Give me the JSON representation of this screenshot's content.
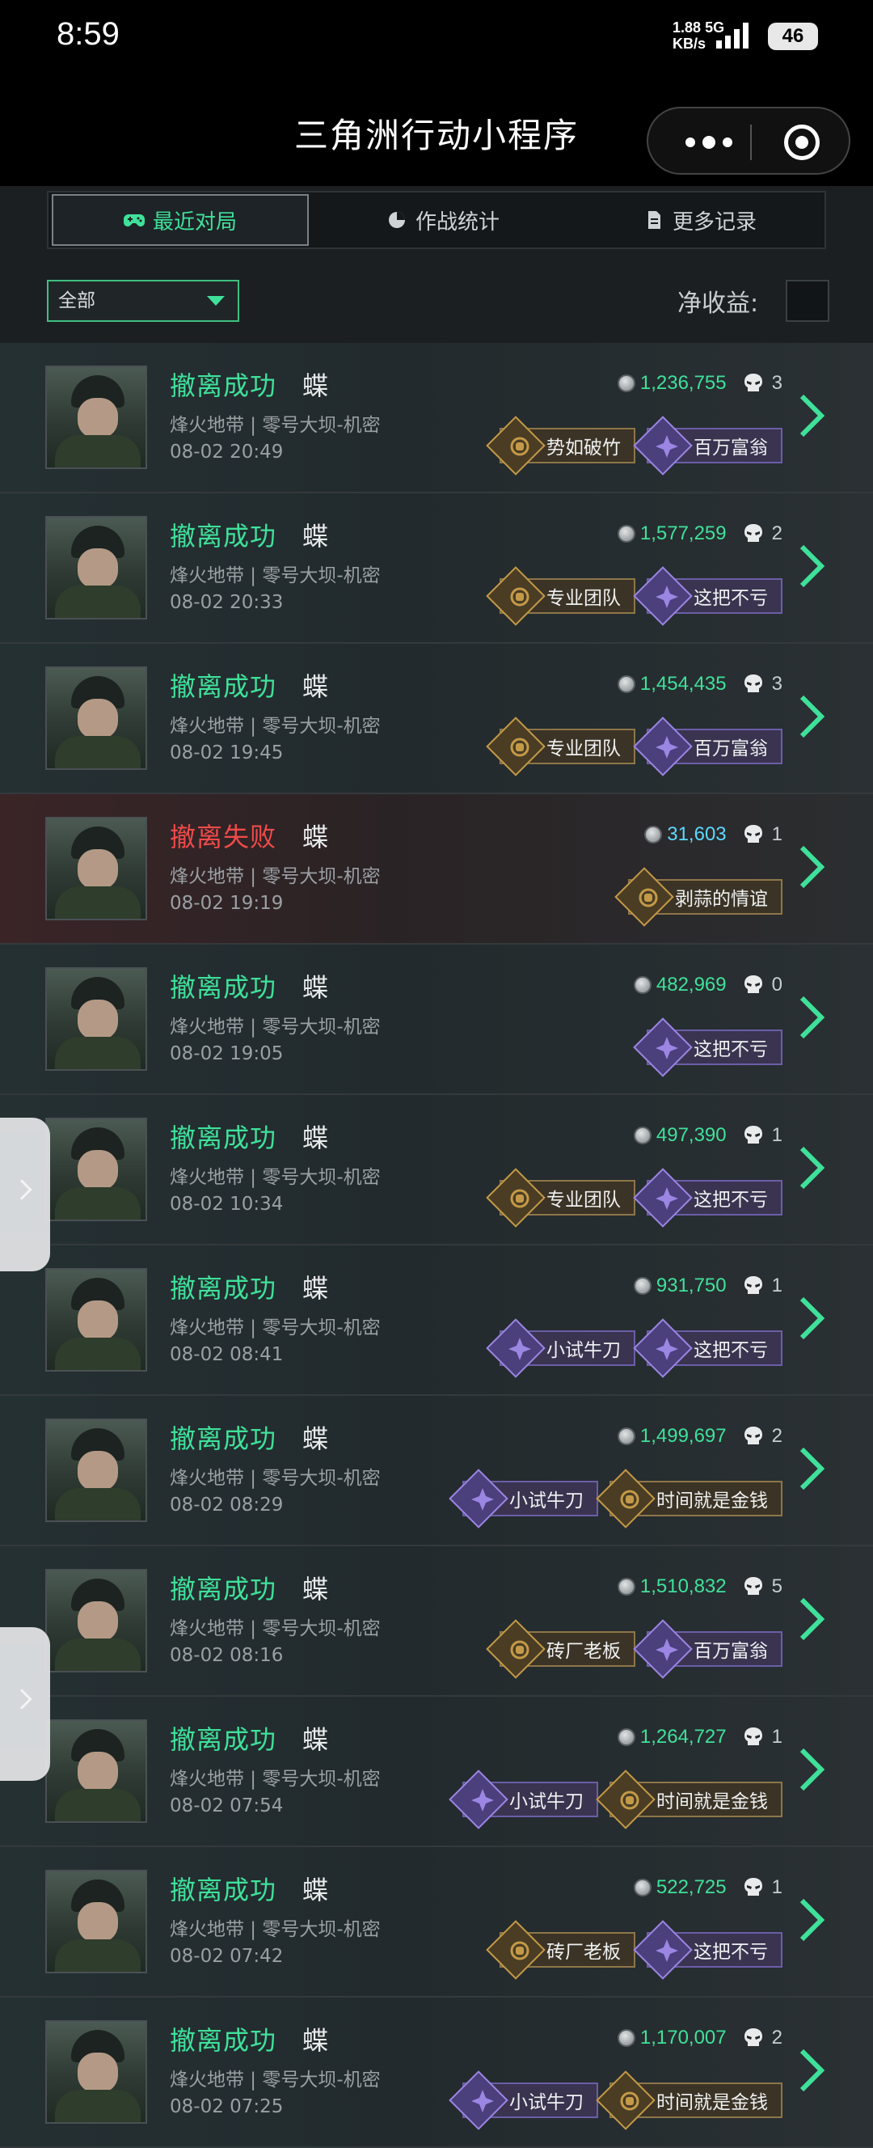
{
  "status_bar": {
    "time": "8:59",
    "net_speed": "1.88",
    "net_unit": "KB/s",
    "network": "5G",
    "battery": "46"
  },
  "app": {
    "title": "三角洲行动小程序"
  },
  "tabs": [
    {
      "label": "最近对局",
      "icon": "gamepad-icon",
      "active": true
    },
    {
      "label": "作战统计",
      "icon": "pie-chart-icon",
      "active": false
    },
    {
      "label": "更多记录",
      "icon": "document-icon",
      "active": false
    }
  ],
  "filter": {
    "selected": "全部",
    "net_income_label": "净收益:"
  },
  "colors": {
    "success": "#3fe19a",
    "fail": "#ef4a4a",
    "value_blue": "#5cd8ff",
    "gold_badge": "#c49a48",
    "purple_badge": "#9b86e3"
  },
  "matches": [
    {
      "status": "撤离成功",
      "result": "success",
      "name": "蝶",
      "map": "烽火地带 | 零号大坝-机密",
      "date": "08-02 20:49",
      "value": "1,236,755",
      "kills": "3",
      "badges": [
        {
          "label": "势如破竹",
          "type": "gold"
        },
        {
          "label": "百万富翁",
          "type": "purple"
        }
      ]
    },
    {
      "status": "撤离成功",
      "result": "success",
      "name": "蝶",
      "map": "烽火地带 | 零号大坝-机密",
      "date": "08-02 20:33",
      "value": "1,577,259",
      "kills": "2",
      "badges": [
        {
          "label": "专业团队",
          "type": "gold"
        },
        {
          "label": "这把不亏",
          "type": "purple"
        }
      ]
    },
    {
      "status": "撤离成功",
      "result": "success",
      "name": "蝶",
      "map": "烽火地带 | 零号大坝-机密",
      "date": "08-02 19:45",
      "value": "1,454,435",
      "kills": "3",
      "badges": [
        {
          "label": "专业团队",
          "type": "gold"
        },
        {
          "label": "百万富翁",
          "type": "purple"
        }
      ]
    },
    {
      "status": "撤离失败",
      "result": "fail",
      "name": "蝶",
      "map": "烽火地带 | 零号大坝-机密",
      "date": "08-02 19:19",
      "value": "31,603",
      "kills": "1",
      "badges": [
        {
          "label": "剥蒜的情谊",
          "type": "gold"
        }
      ]
    },
    {
      "status": "撤离成功",
      "result": "success",
      "name": "蝶",
      "map": "烽火地带 | 零号大坝-机密",
      "date": "08-02 19:05",
      "value": "482,969",
      "kills": "0",
      "badges": [
        {
          "label": "这把不亏",
          "type": "purple"
        }
      ]
    },
    {
      "status": "撤离成功",
      "result": "success",
      "name": "蝶",
      "map": "烽火地带 | 零号大坝-机密",
      "date": "08-02 10:34",
      "value": "497,390",
      "kills": "1",
      "badges": [
        {
          "label": "专业团队",
          "type": "gold"
        },
        {
          "label": "这把不亏",
          "type": "purple"
        }
      ]
    },
    {
      "status": "撤离成功",
      "result": "success",
      "name": "蝶",
      "map": "烽火地带 | 零号大坝-机密",
      "date": "08-02 08:41",
      "value": "931,750",
      "kills": "1",
      "badges": [
        {
          "label": "小试牛刀",
          "type": "purple"
        },
        {
          "label": "这把不亏",
          "type": "purple"
        }
      ]
    },
    {
      "status": "撤离成功",
      "result": "success",
      "name": "蝶",
      "map": "烽火地带 | 零号大坝-机密",
      "date": "08-02 08:29",
      "value": "1,499,697",
      "kills": "2",
      "badges": [
        {
          "label": "小试牛刀",
          "type": "purple"
        },
        {
          "label": "时间就是金钱",
          "type": "gold"
        }
      ]
    },
    {
      "status": "撤离成功",
      "result": "success",
      "name": "蝶",
      "map": "烽火地带 | 零号大坝-机密",
      "date": "08-02 08:16",
      "value": "1,510,832",
      "kills": "5",
      "badges": [
        {
          "label": "砖厂老板",
          "type": "gold"
        },
        {
          "label": "百万富翁",
          "type": "purple"
        }
      ]
    },
    {
      "status": "撤离成功",
      "result": "success",
      "name": "蝶",
      "map": "烽火地带 | 零号大坝-机密",
      "date": "08-02 07:54",
      "value": "1,264,727",
      "kills": "1",
      "badges": [
        {
          "label": "小试牛刀",
          "type": "purple"
        },
        {
          "label": "时间就是金钱",
          "type": "gold"
        }
      ]
    },
    {
      "status": "撤离成功",
      "result": "success",
      "name": "蝶",
      "map": "烽火地带 | 零号大坝-机密",
      "date": "08-02 07:42",
      "value": "522,725",
      "kills": "1",
      "badges": [
        {
          "label": "砖厂老板",
          "type": "gold"
        },
        {
          "label": "这把不亏",
          "type": "purple"
        }
      ]
    },
    {
      "status": "撤离成功",
      "result": "success",
      "name": "蝶",
      "map": "烽火地带 | 零号大坝-机密",
      "date": "08-02 07:25",
      "value": "1,170,007",
      "kills": "2",
      "badges": [
        {
          "label": "小试牛刀",
          "type": "purple"
        },
        {
          "label": "时间就是金钱",
          "type": "gold"
        }
      ]
    }
  ]
}
